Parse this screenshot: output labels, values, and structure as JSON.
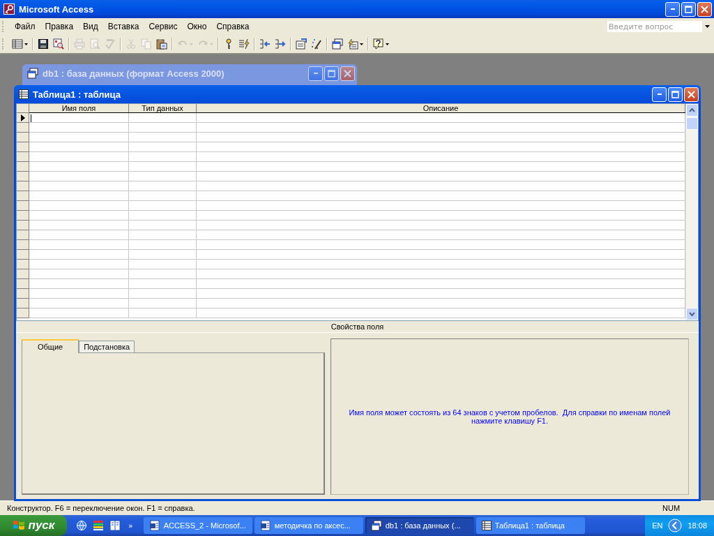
{
  "app_window": {
    "title": "Microsoft Access"
  },
  "menu": [
    "Файл",
    "Правка",
    "Вид",
    "Вставка",
    "Сервис",
    "Окно",
    "Справка"
  ],
  "question_box": {
    "placeholder": "Введите вопрос"
  },
  "toolbar": [
    [
      {
        "kind": "view",
        "disabled": false,
        "dropdown": true
      }
    ],
    [
      {
        "kind": "save",
        "disabled": false,
        "dropdown": false
      },
      {
        "kind": "find",
        "disabled": false,
        "dropdown": false
      }
    ],
    [
      {
        "kind": "print",
        "disabled": true,
        "dropdown": false
      },
      {
        "kind": "preview",
        "disabled": true,
        "dropdown": false
      },
      {
        "kind": "spelling",
        "disabled": true,
        "dropdown": false
      }
    ],
    [
      {
        "kind": "cut",
        "disabled": true,
        "dropdown": false
      },
      {
        "kind": "copy",
        "disabled": true,
        "dropdown": false
      },
      {
        "kind": "paste",
        "disabled": false,
        "dropdown": false
      }
    ],
    [
      {
        "kind": "undo",
        "disabled": true,
        "dropdown": true
      },
      {
        "kind": "redo",
        "disabled": true,
        "dropdown": true
      }
    ],
    [
      {
        "kind": "key",
        "disabled": false,
        "dropdown": false
      },
      {
        "kind": "indexes",
        "disabled": false,
        "dropdown": false
      }
    ],
    [
      {
        "kind": "insert_rows",
        "disabled": false,
        "dropdown": false
      },
      {
        "kind": "delete_rows",
        "disabled": false,
        "dropdown": false
      }
    ],
    [
      {
        "kind": "properties",
        "disabled": false,
        "dropdown": false
      },
      {
        "kind": "build",
        "disabled": false,
        "dropdown": false
      }
    ],
    [
      {
        "kind": "db_window",
        "disabled": false,
        "dropdown": false
      },
      {
        "kind": "new_object",
        "disabled": false,
        "dropdown": true
      }
    ],
    [
      {
        "kind": "help",
        "disabled": false,
        "dropdown": true
      }
    ]
  ],
  "db_window": {
    "title": "db1 : база данных (формат Access 2000)",
    "active": false
  },
  "table_window": {
    "title": "Таблица1 : таблица",
    "active": true,
    "columns": [
      "Имя поля",
      "Тип данных",
      "Описание"
    ],
    "rows": [
      {
        "current": true
      },
      {
        "current": false
      },
      {
        "current": false
      },
      {
        "current": false
      },
      {
        "current": false
      },
      {
        "current": false
      },
      {
        "current": false
      },
      {
        "current": false
      },
      {
        "current": false
      },
      {
        "current": false
      },
      {
        "current": false
      },
      {
        "current": false
      },
      {
        "current": false
      },
      {
        "current": false
      },
      {
        "current": false
      },
      {
        "current": false
      },
      {
        "current": false
      },
      {
        "current": false
      },
      {
        "current": false
      },
      {
        "current": false
      },
      {
        "current": false
      }
    ],
    "properties_label": "Свойства поля",
    "tabs": [
      {
        "label": "Общие",
        "selected": true
      },
      {
        "label": "Подстановка",
        "selected": false
      }
    ],
    "hint": "Имя поля может состоять из 64 знаков с учетом пробелов.  Для справки по именам полей нажмите клавишу F1."
  },
  "status_bar": {
    "text": "Конструктор.  F6 = переключение окон.  F1 = справка.",
    "indicator": "NUM"
  },
  "taskbar": {
    "start": "пуск",
    "quick_launch": [
      {
        "kind": "browser"
      },
      {
        "kind": "colors"
      },
      {
        "kind": "book"
      }
    ],
    "more": "»",
    "tasks": [
      {
        "label": "ACCESS_2 - Microsof...",
        "kind": "word",
        "selected": false
      },
      {
        "label": "методичка по аксес...",
        "kind": "word",
        "selected": false
      },
      {
        "label": "db1 : база данных (...",
        "kind": "db",
        "selected": true
      },
      {
        "label": "Таблица1 : таблица",
        "kind": "table",
        "selected": false
      }
    ],
    "language": "EN",
    "clock": "18:08"
  }
}
